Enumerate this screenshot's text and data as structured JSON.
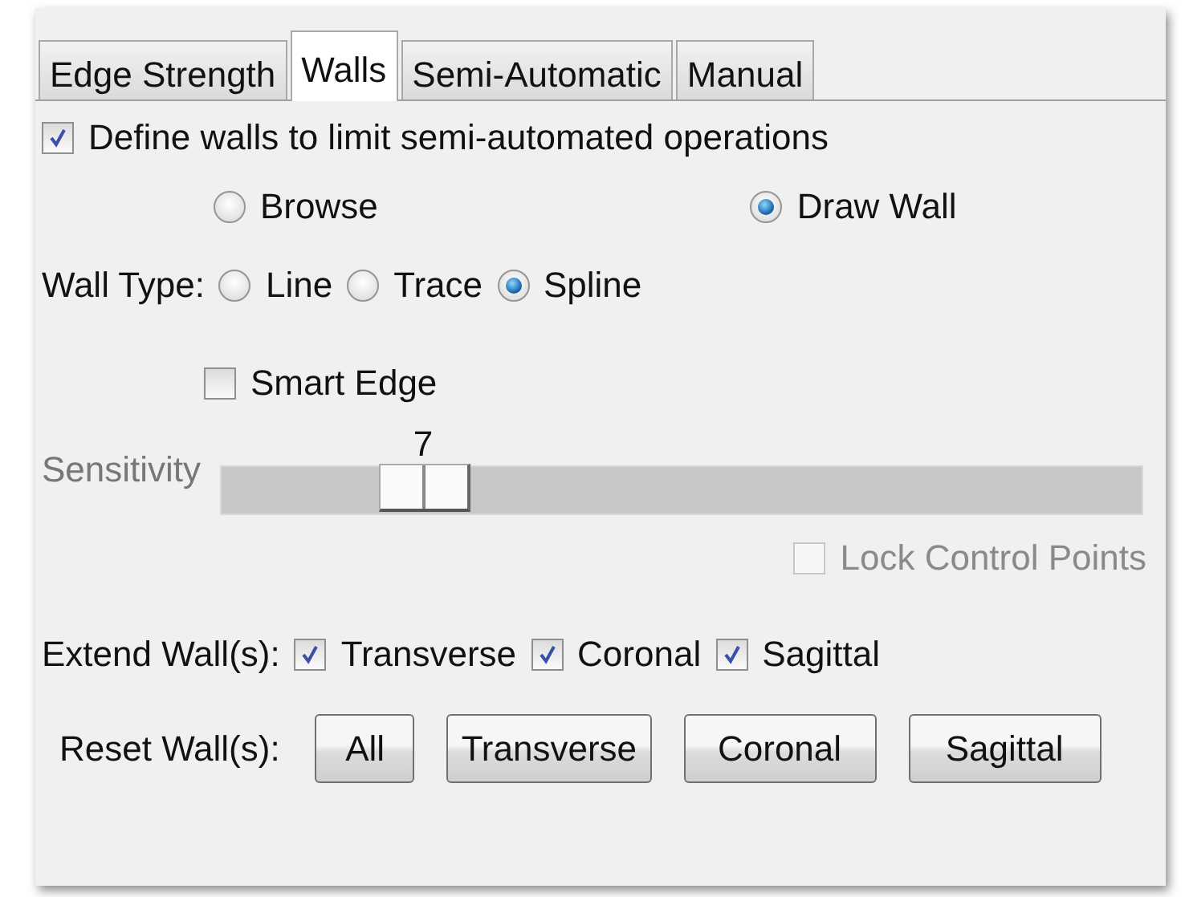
{
  "tabs": [
    {
      "label": "Edge Strength",
      "selected": false
    },
    {
      "label": "Walls",
      "selected": true
    },
    {
      "label": "Semi-Automatic",
      "selected": false
    },
    {
      "label": "Manual",
      "selected": false
    }
  ],
  "define_walls": {
    "label": "Define walls to limit semi-automated operations",
    "checked": true
  },
  "mode": [
    {
      "label": "Browse",
      "selected": false
    },
    {
      "label": "Draw Wall",
      "selected": true
    }
  ],
  "wall_type": {
    "label": "Wall Type:",
    "options": [
      {
        "label": "Line",
        "selected": false
      },
      {
        "label": "Trace",
        "selected": false
      },
      {
        "label": "Spline",
        "selected": true
      }
    ]
  },
  "smart_edge": {
    "label": "Smart Edge",
    "checked": false
  },
  "sensitivity": {
    "label": "Sensitivity",
    "value": "7",
    "level": 0.22
  },
  "lock_control_points": {
    "label": "Lock Control Points",
    "checked": false,
    "disabled": true
  },
  "extend_walls": {
    "label": "Extend Wall(s):",
    "options": [
      {
        "label": "Transverse",
        "checked": true
      },
      {
        "label": "Coronal",
        "checked": true
      },
      {
        "label": "Sagittal",
        "checked": true
      }
    ]
  },
  "reset_walls": {
    "label": "Reset Wall(s):",
    "buttons": [
      "All",
      "Transverse",
      "Coronal",
      "Sagittal"
    ]
  }
}
